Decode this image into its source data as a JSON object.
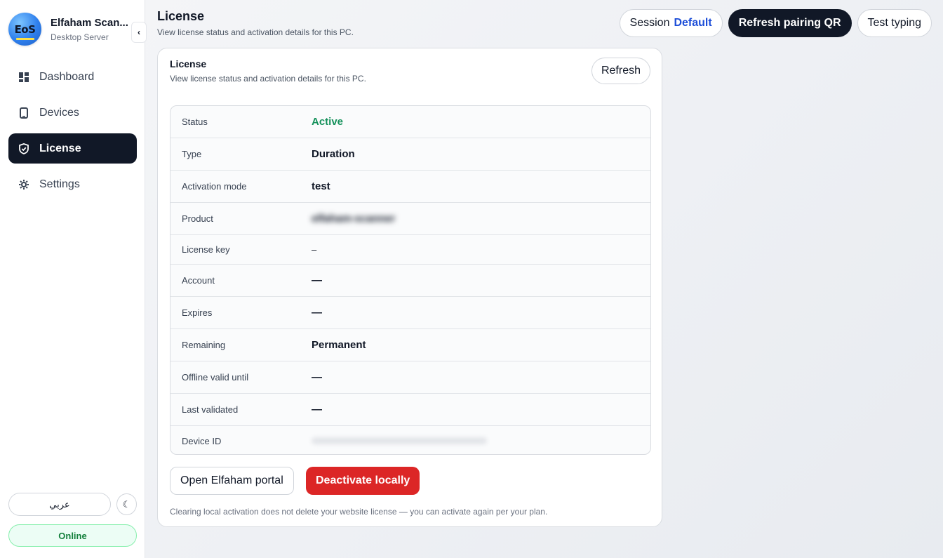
{
  "sidebar": {
    "brand_title": "Elfaham Scan...",
    "brand_subtitle": "Desktop Server",
    "logo_text": "EoS",
    "collapse_glyph": "‹",
    "items": [
      {
        "label": "Dashboard",
        "icon": "dashboard-icon",
        "active": false
      },
      {
        "label": "Devices",
        "icon": "phone-icon",
        "active": false
      },
      {
        "label": "License",
        "icon": "shield-check-icon",
        "active": true
      },
      {
        "label": "Settings",
        "icon": "gear-icon",
        "active": false
      }
    ],
    "language_label": "عربي",
    "theme_glyph": "☾",
    "status_label": "Online"
  },
  "header": {
    "title": "License",
    "subtitle": "View license status and activation details for this PC.",
    "session_label": "Session",
    "session_value": "Default",
    "refresh_qr_label": "Refresh pairing QR",
    "test_typing_label": "Test typing"
  },
  "card": {
    "title": "License",
    "subtitle": "View license status and activation details for this PC.",
    "refresh_label": "Refresh",
    "rows": [
      {
        "key": "Status",
        "value": "Active"
      },
      {
        "key": "Type",
        "value": "Duration"
      },
      {
        "key": "Activation mode",
        "value": "test"
      },
      {
        "key": "Product",
        "value": "elfaham-scanner"
      },
      {
        "key": "License key",
        "value": "–"
      },
      {
        "key": "Account",
        "value": "—"
      },
      {
        "key": "Expires",
        "value": "—"
      },
      {
        "key": "Remaining",
        "value": "Permanent"
      },
      {
        "key": "Offline valid until",
        "value": "—"
      },
      {
        "key": "Last validated",
        "value": "—"
      },
      {
        "key": "Device ID",
        "value": ""
      }
    ],
    "portal_label": "Open Elfaham portal",
    "deactivate_label": "Deactivate locally",
    "footnote": "Clearing local activation does not delete your website license — you can activate again per your plan."
  },
  "colors": {
    "accent_dark": "#111827",
    "active_green": "#15915b",
    "danger_red": "#dc2626",
    "session_blue": "#1d4ed8"
  }
}
